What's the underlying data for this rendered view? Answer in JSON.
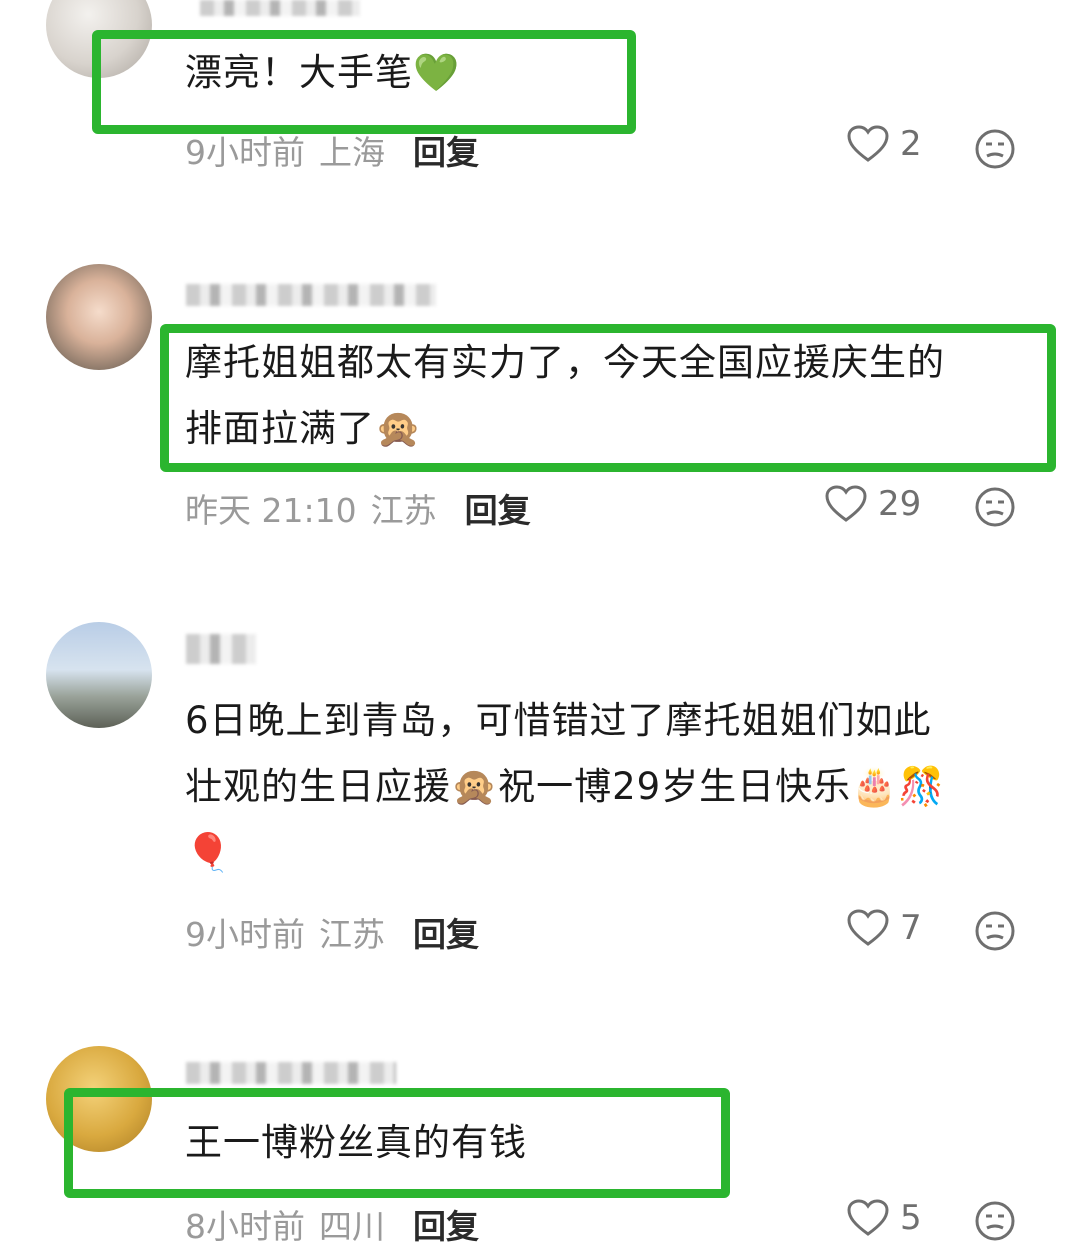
{
  "comments": [
    {
      "text": "漂亮！大手笔💚",
      "time": "9小时前",
      "location": "上海",
      "reply": "回复",
      "likes": "2"
    },
    {
      "text_line1": "摩托姐姐都太有实力了，今天全国应援庆生的",
      "text_line2": "排面拉满了🙊",
      "time": "昨天 21:10",
      "location": "江苏",
      "reply": "回复",
      "likes": "29"
    },
    {
      "text_line1": "6日晚上到青岛，可惜错过了摩托姐姐们如此",
      "text_line2": "壮观的生日应援🙊祝一博29岁生日快乐🎂🎊",
      "text_line3": "🎈",
      "time": "9小时前",
      "location": "江苏",
      "reply": "回复",
      "likes": "7"
    },
    {
      "text": "王一博粉丝真的有钱",
      "time": "8小时前",
      "location": "四川",
      "reply": "回复",
      "likes": "5"
    }
  ],
  "highlight_color": "#2bb52f",
  "icons": [
    "heart-icon",
    "dislike-face-icon"
  ]
}
